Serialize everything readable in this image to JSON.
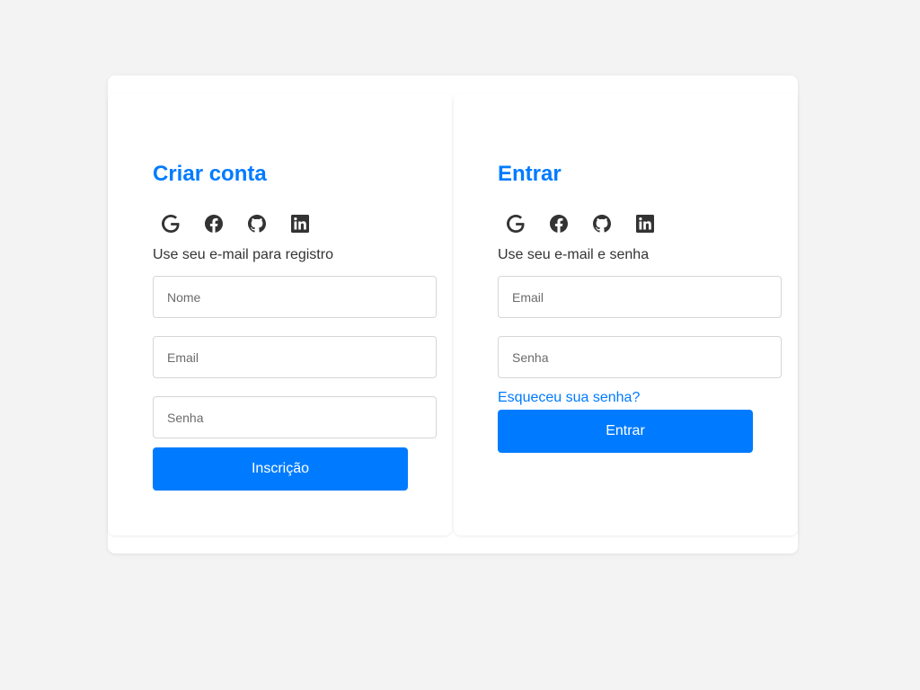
{
  "signup": {
    "title": "Criar conta",
    "hint": "Use seu e-mail para registro",
    "name_placeholder": "Nome",
    "email_placeholder": "Email",
    "password_placeholder": "Senha",
    "submit_label": "Inscrição"
  },
  "signin": {
    "title": "Entrar",
    "hint": "Use seu e-mail e senha",
    "email_placeholder": "Email",
    "password_placeholder": "Senha",
    "forgot_label": "Esqueceu sua senha?",
    "submit_label": "Entrar"
  },
  "social_icons": [
    "google-icon",
    "facebook-icon",
    "github-icon",
    "linkedin-icon"
  ],
  "colors": {
    "accent": "#007bff",
    "background": "#f3f3f3",
    "card": "#ffffff",
    "text": "#333333",
    "icon": "#333333"
  }
}
